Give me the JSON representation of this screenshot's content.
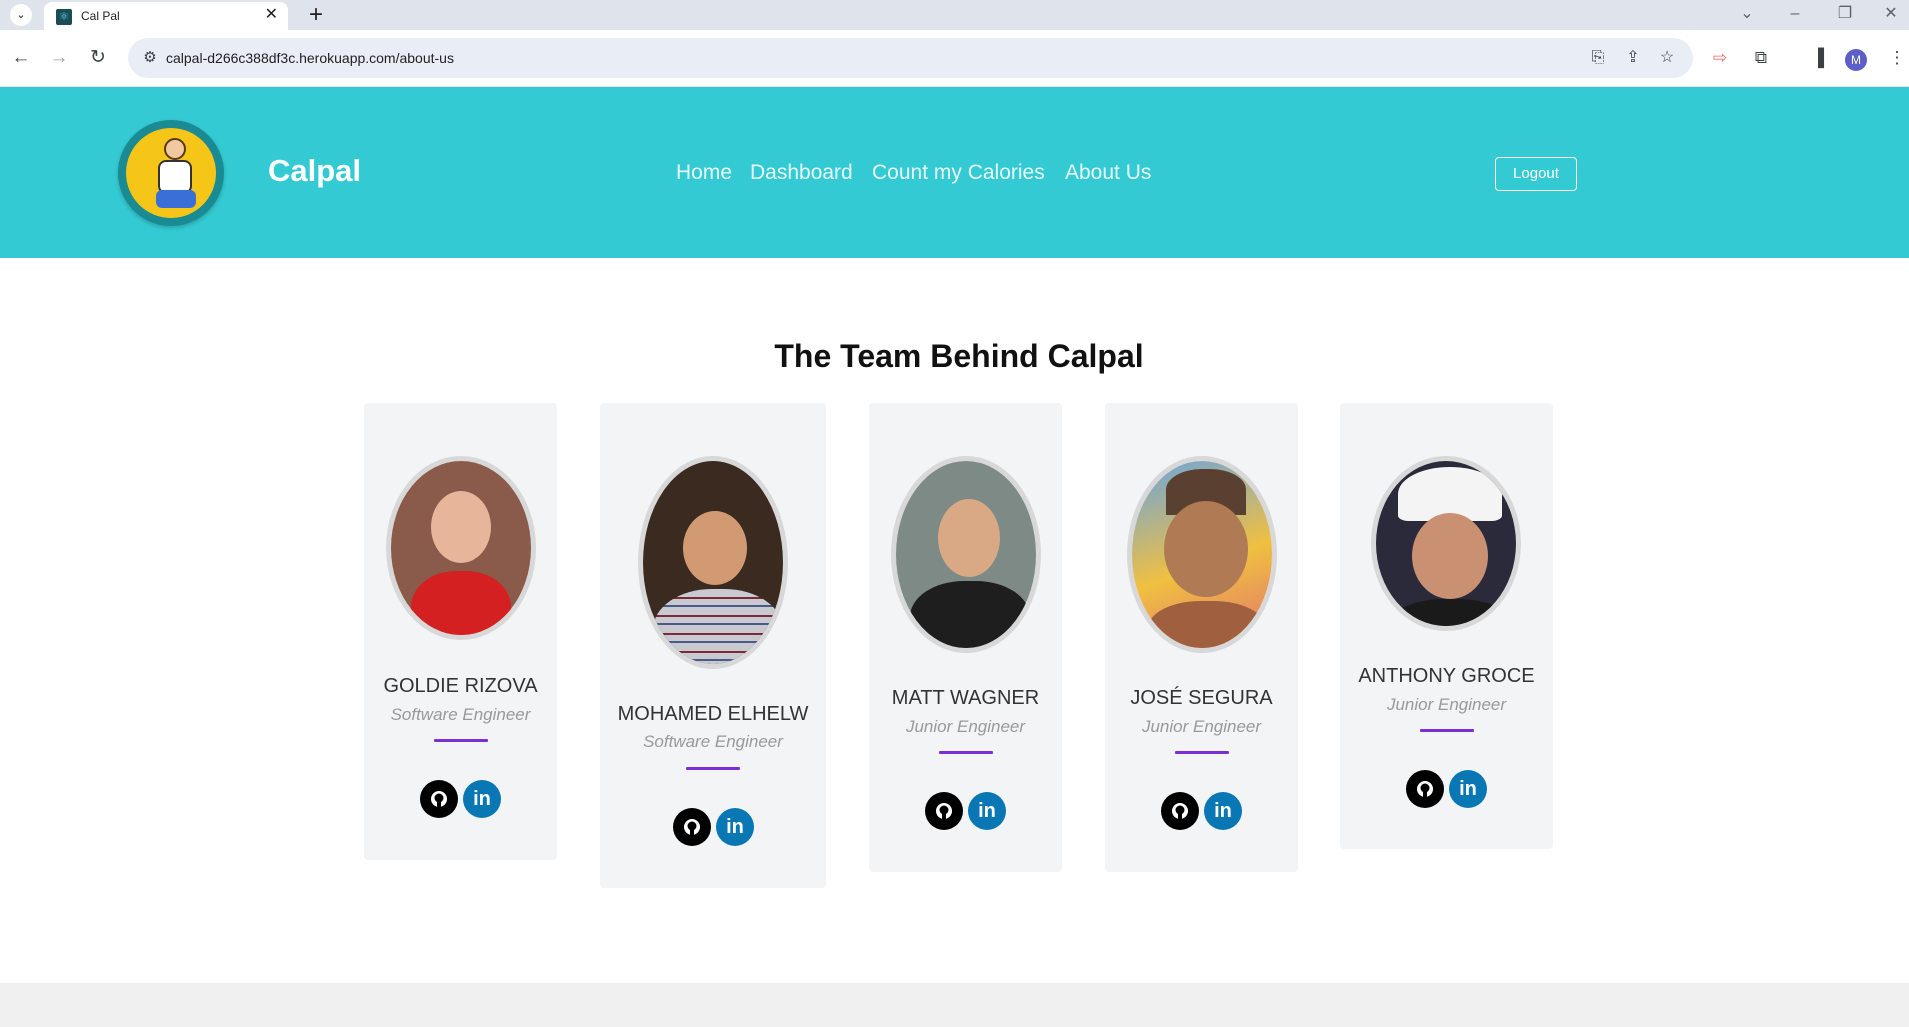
{
  "browser": {
    "tab_title": "Cal Pal",
    "url": "calpal-d266c388df3c.herokuapp.com/about-us",
    "profile_initial": "M",
    "new_tab_label": "+",
    "close_tab_label": "✕"
  },
  "header": {
    "brand": "Calpal",
    "nav": [
      "Home",
      "Dashboard",
      "Count my Calories",
      "About Us"
    ],
    "logout_label": "Logout"
  },
  "main": {
    "title": "The Team Behind Calpal",
    "members": [
      {
        "name": "GOLDIE RIZOVA",
        "role": "Software Engineer"
      },
      {
        "name": "MOHAMED ELHELW",
        "role": "Software Engineer"
      },
      {
        "name": "MATT WAGNER",
        "role": "Junior Engineer"
      },
      {
        "name": "JOSÉ SEGURA",
        "role": "Junior Engineer"
      },
      {
        "name": "ANTHONY GROCE",
        "role": "Junior Engineer"
      }
    ],
    "social": {
      "github_icon": "github-icon",
      "linkedin_label": "in"
    }
  },
  "colors": {
    "header_bg": "#34cad3",
    "card_bg": "#f3f4f6",
    "divider": "#7b2fd6",
    "linkedin": "#0a77b5"
  }
}
